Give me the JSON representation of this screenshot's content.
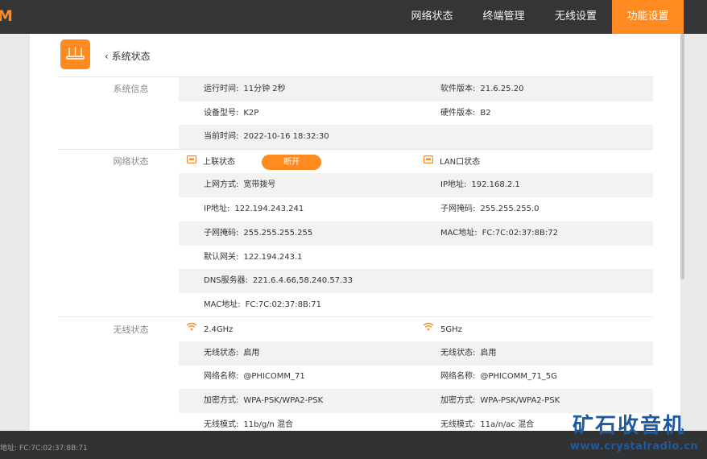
{
  "header": {
    "logo_letter": "M",
    "nav": [
      {
        "label": "网络状态",
        "active": false
      },
      {
        "label": "终端管理",
        "active": false
      },
      {
        "label": "无线设置",
        "active": false
      },
      {
        "label": "功能设置",
        "active": true
      }
    ]
  },
  "breadcrumb": {
    "back_label": "系统状态"
  },
  "colors": {
    "accent": "#ff8a1f",
    "topbar": "#333536",
    "row_shade": "#f2f2f2",
    "watermark": "#1d5aa0"
  },
  "system_info": {
    "title": "系统信息",
    "uptime_label": "运行时间:",
    "uptime_value": "11分钟 2秒",
    "software_label": "软件版本:",
    "software_value": "21.6.25.20",
    "model_label": "设备型号:",
    "model_value": "K2P",
    "hardware_label": "硬件版本:",
    "hardware_value": "B2",
    "time_label": "当前时间:",
    "time_value": "2022-10-16 18:32:30"
  },
  "network_status": {
    "title": "网络状态",
    "wan": {
      "header": "上联状态",
      "button": "断开",
      "mode_label": "上网方式:",
      "mode_value": "宽带拨号",
      "ip_label": "IP地址:",
      "ip_value": "122.194.243.241",
      "mask_label": "子网掩码:",
      "mask_value": "255.255.255.255",
      "gateway_label": "默认网关:",
      "gateway_value": "122.194.243.1",
      "dns_label": "DNS服务器:",
      "dns_value": "221.6.4.66,58.240.57.33",
      "mac_label": "MAC地址:",
      "mac_value": "FC:7C:02:37:8B:71"
    },
    "lan": {
      "header": "LAN口状态",
      "ip_label": "IP地址:",
      "ip_value": "192.168.2.1",
      "mask_label": "子网掩码:",
      "mask_value": "255.255.255.0",
      "mac_label": "MAC地址:",
      "mac_value": "FC:7C:02:37:8B:72"
    }
  },
  "wireless_status": {
    "title": "无线状态",
    "band24": {
      "header": "2.4GHz",
      "state_label": "无线状态:",
      "state_value": "启用",
      "ssid_label": "网络名称:",
      "ssid_value": "@PHICOMM_71",
      "enc_label": "加密方式:",
      "enc_value": "WPA-PSK/WPA2-PSK",
      "mode_label": "无线模式:",
      "mode_value": "11b/g/n 混合"
    },
    "band5": {
      "header": "5GHz",
      "state_label": "无线状态:",
      "state_value": "启用",
      "ssid_label": "网络名称:",
      "ssid_value": "@PHICOMM_71_5G",
      "enc_label": "加密方式:",
      "enc_value": "WPA-PSK/WPA2-PSK",
      "mode_label": "无线模式:",
      "mode_value": "11a/n/ac 混合"
    }
  },
  "footer": {
    "mac_text": "地址: FC:7C:02:37:8B:71"
  },
  "watermark": {
    "text": "矿石收音机",
    "url": "www.crystalradio.cn"
  }
}
